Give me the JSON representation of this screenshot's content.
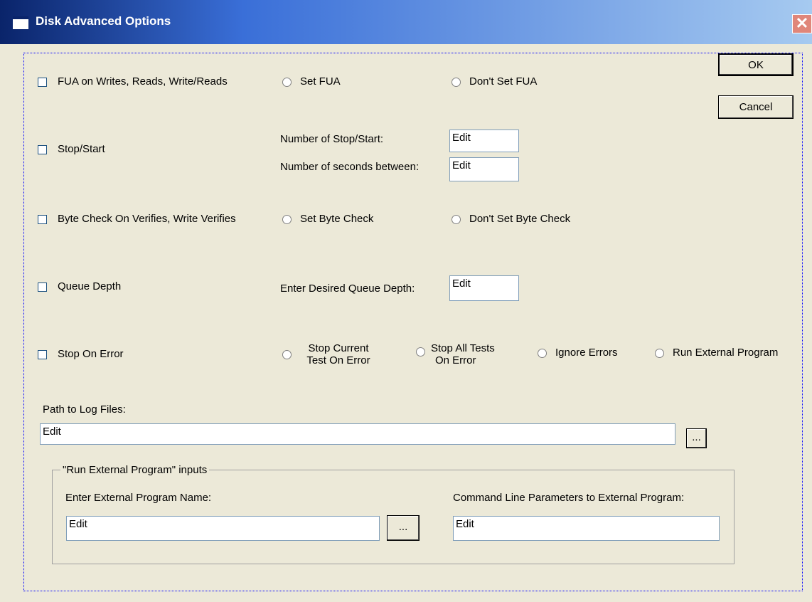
{
  "window": {
    "title": "Disk Advanced Options",
    "close": "✕"
  },
  "buttons": {
    "ok": "OK",
    "cancel": "Cancel",
    "browse_log": "...",
    "browse_program": "..."
  },
  "rows": {
    "fua": {
      "label": "FUA on Writes, Reads, Write/Reads",
      "opt1": "Set FUA",
      "opt2": "Don't Set FUA"
    },
    "stop_start": {
      "label": "Stop/Start",
      "num_label": "Number of Stop/Start:",
      "num_value": "Edit",
      "secs_label": "Number of seconds between:",
      "secs_value": "Edit"
    },
    "byte_check": {
      "label": "Byte Check On Verifies, Write Verifies",
      "opt1": "Set  Byte Check",
      "opt2": "Don't Set Byte Check"
    },
    "queue_depth": {
      "label": "Queue Depth",
      "field_label": "Enter Desired Queue Depth:",
      "field_value": "Edit"
    },
    "stop_on_error": {
      "label": "Stop On Error",
      "opt1_line1": "Stop Current",
      "opt1_line2": "Test On Error",
      "opt2_line1": "Stop All Tests",
      "opt2_line2": "On Error",
      "opt3": "Ignore Errors",
      "opt4": "Run External Program"
    }
  },
  "log": {
    "label": "Path to Log Files:",
    "value": "Edit"
  },
  "external": {
    "group_label": "\"Run External Program\" inputs",
    "name_label": "Enter External Program Name:",
    "name_value": "Edit",
    "params_label": "Command Line Parameters to External Program:",
    "params_value": "Edit"
  }
}
